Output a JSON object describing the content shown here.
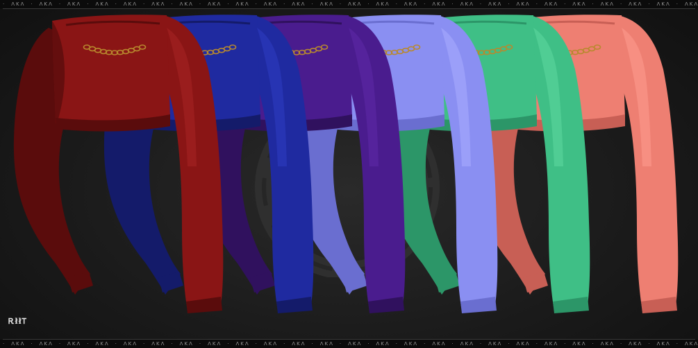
{
  "border": {
    "pattern": [
      "·",
      "ΛKΛ"
    ]
  },
  "signature_mark": "ᎡłłᎢ",
  "colors": {
    "background": "#1b1b1b",
    "variants": [
      {
        "name": "red",
        "fill": "#8a1515",
        "shade": "#5a0c0c",
        "light": "#a82424"
      },
      {
        "name": "blue",
        "fill": "#1f2aa0",
        "shade": "#141b6a",
        "light": "#2e3cc2"
      },
      {
        "name": "purple",
        "fill": "#4a1c8e",
        "shade": "#30115e",
        "light": "#5e2aa8"
      },
      {
        "name": "periwinkle",
        "fill": "#8a8ff2",
        "shade": "#6a6ed0",
        "light": "#a9adff"
      },
      {
        "name": "mint",
        "fill": "#3fbf86",
        "shade": "#2c9668",
        "light": "#5fd8a0"
      },
      {
        "name": "salmon",
        "fill": "#ee7f72",
        "shade": "#c85f55",
        "light": "#ff9d90"
      }
    ],
    "chain": "#b8892e"
  },
  "items": [
    {
      "id": "cropped-shrug-red"
    },
    {
      "id": "cropped-shrug-blue"
    },
    {
      "id": "cropped-shrug-purple"
    },
    {
      "id": "cropped-shrug-periwinkle"
    },
    {
      "id": "cropped-shrug-mint"
    },
    {
      "id": "cropped-shrug-salmon"
    }
  ]
}
